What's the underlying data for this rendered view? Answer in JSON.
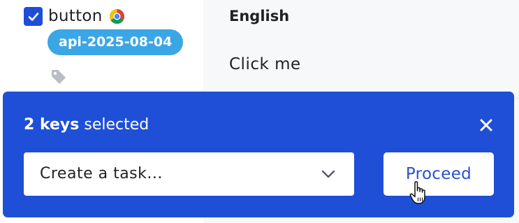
{
  "key_row": {
    "name": "button",
    "checked": true,
    "tag": "api-2025-08-04",
    "icons": {
      "checkbox": "checkmark-icon",
      "browser": "chrome-icon",
      "tag": "tag-icon"
    }
  },
  "translation_column": {
    "language": "English",
    "value": "Click me"
  },
  "selection_bar": {
    "count": "2 keys",
    "suffix": " selected",
    "action_placeholder": "Create a task...",
    "proceed_label": "Proceed",
    "close_icon": "close-icon"
  },
  "colors": {
    "accent": "#1f4fd6",
    "tag_badge": "#3ba6e6",
    "checkbox": "#1d4ed8",
    "proceed_text": "#2b4fd0"
  }
}
